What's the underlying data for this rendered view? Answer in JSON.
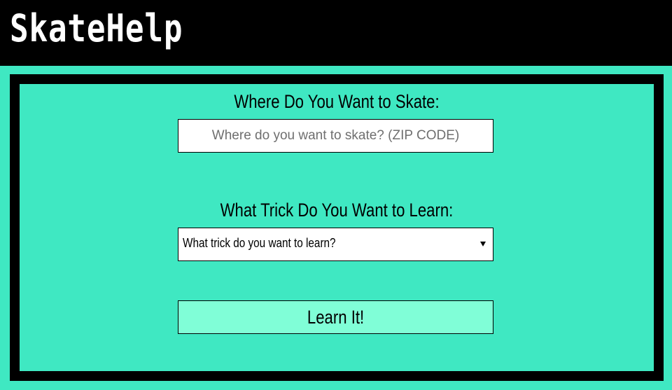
{
  "header": {
    "brand": "SkateHelp"
  },
  "form": {
    "location_label": "Where Do You Want to Skate:",
    "location_placeholder": "Where do you want to skate? (ZIP CODE)",
    "location_value": "",
    "trick_label": "What Trick Do You Want to Learn:",
    "trick_selected": "What trick do you want to learn?",
    "submit_label": "Learn It!"
  },
  "colors": {
    "header_bg": "#000000",
    "page_bg": "#3fe8c2",
    "panel_border": "#000000",
    "button_bg": "#80fed7",
    "input_bg": "#ffffff"
  },
  "icons": {
    "dropdown": "chevron-down-icon"
  }
}
